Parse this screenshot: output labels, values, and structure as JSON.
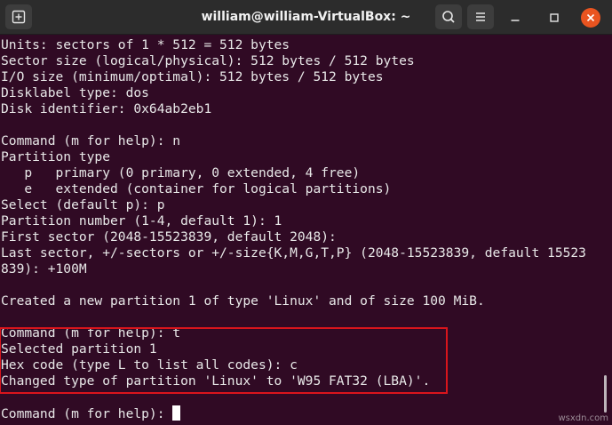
{
  "window": {
    "title": "william@william-VirtualBox: ~"
  },
  "icons": {
    "new_tab": "new-tab-icon",
    "search": "search-icon",
    "menu": "hamburger-menu-icon",
    "minimize": "minimize-icon",
    "maximize": "maximize-icon",
    "close": "close-icon"
  },
  "colors": {
    "terminal_background": "#300a24",
    "titlebar": "#2c2c2c",
    "close_button": "#e95420",
    "highlight_box": "#d9151c"
  },
  "terminal": {
    "lines": [
      "Units: sectors of 1 * 512 = 512 bytes",
      "Sector size (logical/physical): 512 bytes / 512 bytes",
      "I/O size (minimum/optimal): 512 bytes / 512 bytes",
      "Disklabel type: dos",
      "Disk identifier: 0x64ab2eb1",
      "",
      "Command (m for help): n",
      "Partition type",
      "   p   primary (0 primary, 0 extended, 4 free)",
      "   e   extended (container for logical partitions)",
      "Select (default p): p",
      "Partition number (1-4, default 1): 1",
      "First sector (2048-15523839, default 2048):",
      "Last sector, +/-sectors or +/-size{K,M,G,T,P} (2048-15523839, default 15523",
      "839): +100M",
      "",
      "Created a new partition 1 of type 'Linux' and of size 100 MiB.",
      "",
      "Command (m for help): t",
      "Selected partition 1",
      "Hex code (type L to list all codes): c",
      "Changed type of partition 'Linux' to 'W95 FAT32 (LBA)'.",
      "",
      "Command (m for help): "
    ]
  },
  "watermark": "wsxdn.com"
}
